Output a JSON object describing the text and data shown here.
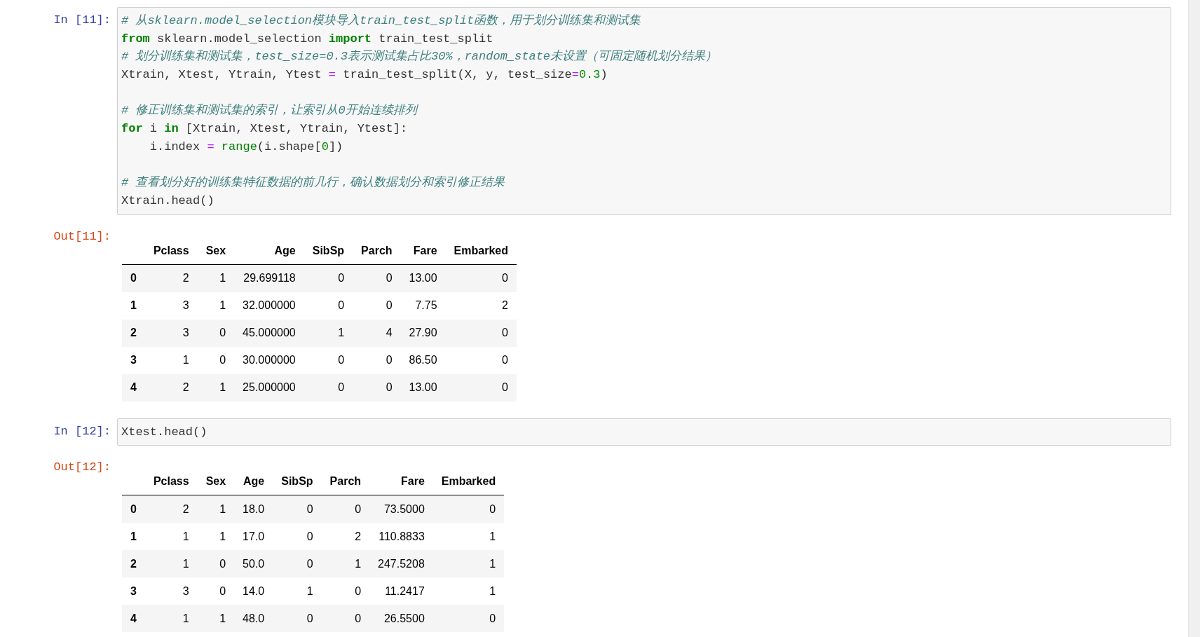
{
  "cells": [
    {
      "prompt": "In [11]:",
      "lines": [
        {
          "kind": "code",
          "tokens": [
            {
              "kind": "comment",
              "text": "# 从sklearn.model_selection模块导入train_test_split函数，用于划分训练集和测试集"
            }
          ]
        },
        {
          "kind": "code",
          "tokens": [
            {
              "kind": "keyword",
              "text": "from"
            },
            {
              "kind": "plain",
              "text": " sklearn.model_selection "
            },
            {
              "kind": "keyword",
              "text": "import"
            },
            {
              "kind": "plain",
              "text": " train_test_split"
            }
          ]
        },
        {
          "kind": "code",
          "tokens": [
            {
              "kind": "comment",
              "text": "# 划分训练集和测试集，test_size=0.3表示测试集占比30%，random_state未设置（可固定随机划分结果）"
            }
          ]
        },
        {
          "kind": "code",
          "tokens": [
            {
              "kind": "plain",
              "text": "Xtrain, Xtest, Ytrain, Ytest "
            },
            {
              "kind": "operator",
              "text": "="
            },
            {
              "kind": "plain",
              "text": " train_test_split(X, y, test_size"
            },
            {
              "kind": "operator",
              "text": "="
            },
            {
              "kind": "number",
              "text": "0.3"
            },
            {
              "kind": "plain",
              "text": ")"
            }
          ]
        },
        {
          "kind": "blank"
        },
        {
          "kind": "code",
          "tokens": [
            {
              "kind": "comment",
              "text": "# 修正训练集和测试集的索引，让索引从0开始连续排列"
            }
          ]
        },
        {
          "kind": "code",
          "tokens": [
            {
              "kind": "keyword",
              "text": "for"
            },
            {
              "kind": "plain",
              "text": " i "
            },
            {
              "kind": "keyword",
              "text": "in"
            },
            {
              "kind": "plain",
              "text": " [Xtrain, Xtest, Ytrain, Ytest]:"
            }
          ]
        },
        {
          "kind": "code",
          "tokens": [
            {
              "kind": "plain",
              "text": "    i.index "
            },
            {
              "kind": "operator",
              "text": "= "
            },
            {
              "kind": "builtin",
              "text": "range"
            },
            {
              "kind": "plain",
              "text": "(i.shape["
            },
            {
              "kind": "number",
              "text": "0"
            },
            {
              "kind": "plain",
              "text": "])"
            }
          ]
        },
        {
          "kind": "blank"
        },
        {
          "kind": "code",
          "tokens": [
            {
              "kind": "comment",
              "text": "# 查看划分好的训练集特征数据的前几行，确认数据划分和索引修正结果"
            }
          ]
        },
        {
          "kind": "code",
          "tokens": [
            {
              "kind": "plain",
              "text": "Xtrain.head()"
            }
          ]
        }
      ],
      "output": {
        "prompt": "Out[11]:",
        "columns": [
          "Pclass",
          "Sex",
          "Age",
          "SibSp",
          "Parch",
          "Fare",
          "Embarked"
        ],
        "rows": [
          {
            "index": "0",
            "values": [
              "2",
              "1",
              "29.699118",
              "0",
              "0",
              "13.00",
              "0"
            ]
          },
          {
            "index": "1",
            "values": [
              "3",
              "1",
              "32.000000",
              "0",
              "0",
              "7.75",
              "2"
            ]
          },
          {
            "index": "2",
            "values": [
              "3",
              "0",
              "45.000000",
              "1",
              "4",
              "27.90",
              "0"
            ]
          },
          {
            "index": "3",
            "values": [
              "1",
              "0",
              "30.000000",
              "0",
              "0",
              "86.50",
              "0"
            ]
          },
          {
            "index": "4",
            "values": [
              "2",
              "1",
              "25.000000",
              "0",
              "0",
              "13.00",
              "0"
            ]
          }
        ]
      }
    },
    {
      "prompt": "In [12]:",
      "lines": [
        {
          "kind": "code",
          "tokens": [
            {
              "kind": "plain",
              "text": "Xtest.head()"
            }
          ]
        }
      ],
      "output": {
        "prompt": "Out[12]:",
        "columns": [
          "Pclass",
          "Sex",
          "Age",
          "SibSp",
          "Parch",
          "Fare",
          "Embarked"
        ],
        "rows": [
          {
            "index": "0",
            "values": [
              "2",
              "1",
              "18.0",
              "0",
              "0",
              "73.5000",
              "0"
            ]
          },
          {
            "index": "1",
            "values": [
              "1",
              "1",
              "17.0",
              "0",
              "2",
              "110.8833",
              "1"
            ]
          },
          {
            "index": "2",
            "values": [
              "1",
              "0",
              "50.0",
              "0",
              "1",
              "247.5208",
              "1"
            ]
          },
          {
            "index": "3",
            "values": [
              "3",
              "0",
              "14.0",
              "1",
              "0",
              "11.2417",
              "1"
            ]
          },
          {
            "index": "4",
            "values": [
              "1",
              "1",
              "48.0",
              "0",
              "0",
              "26.5500",
              "0"
            ]
          }
        ]
      }
    }
  ]
}
